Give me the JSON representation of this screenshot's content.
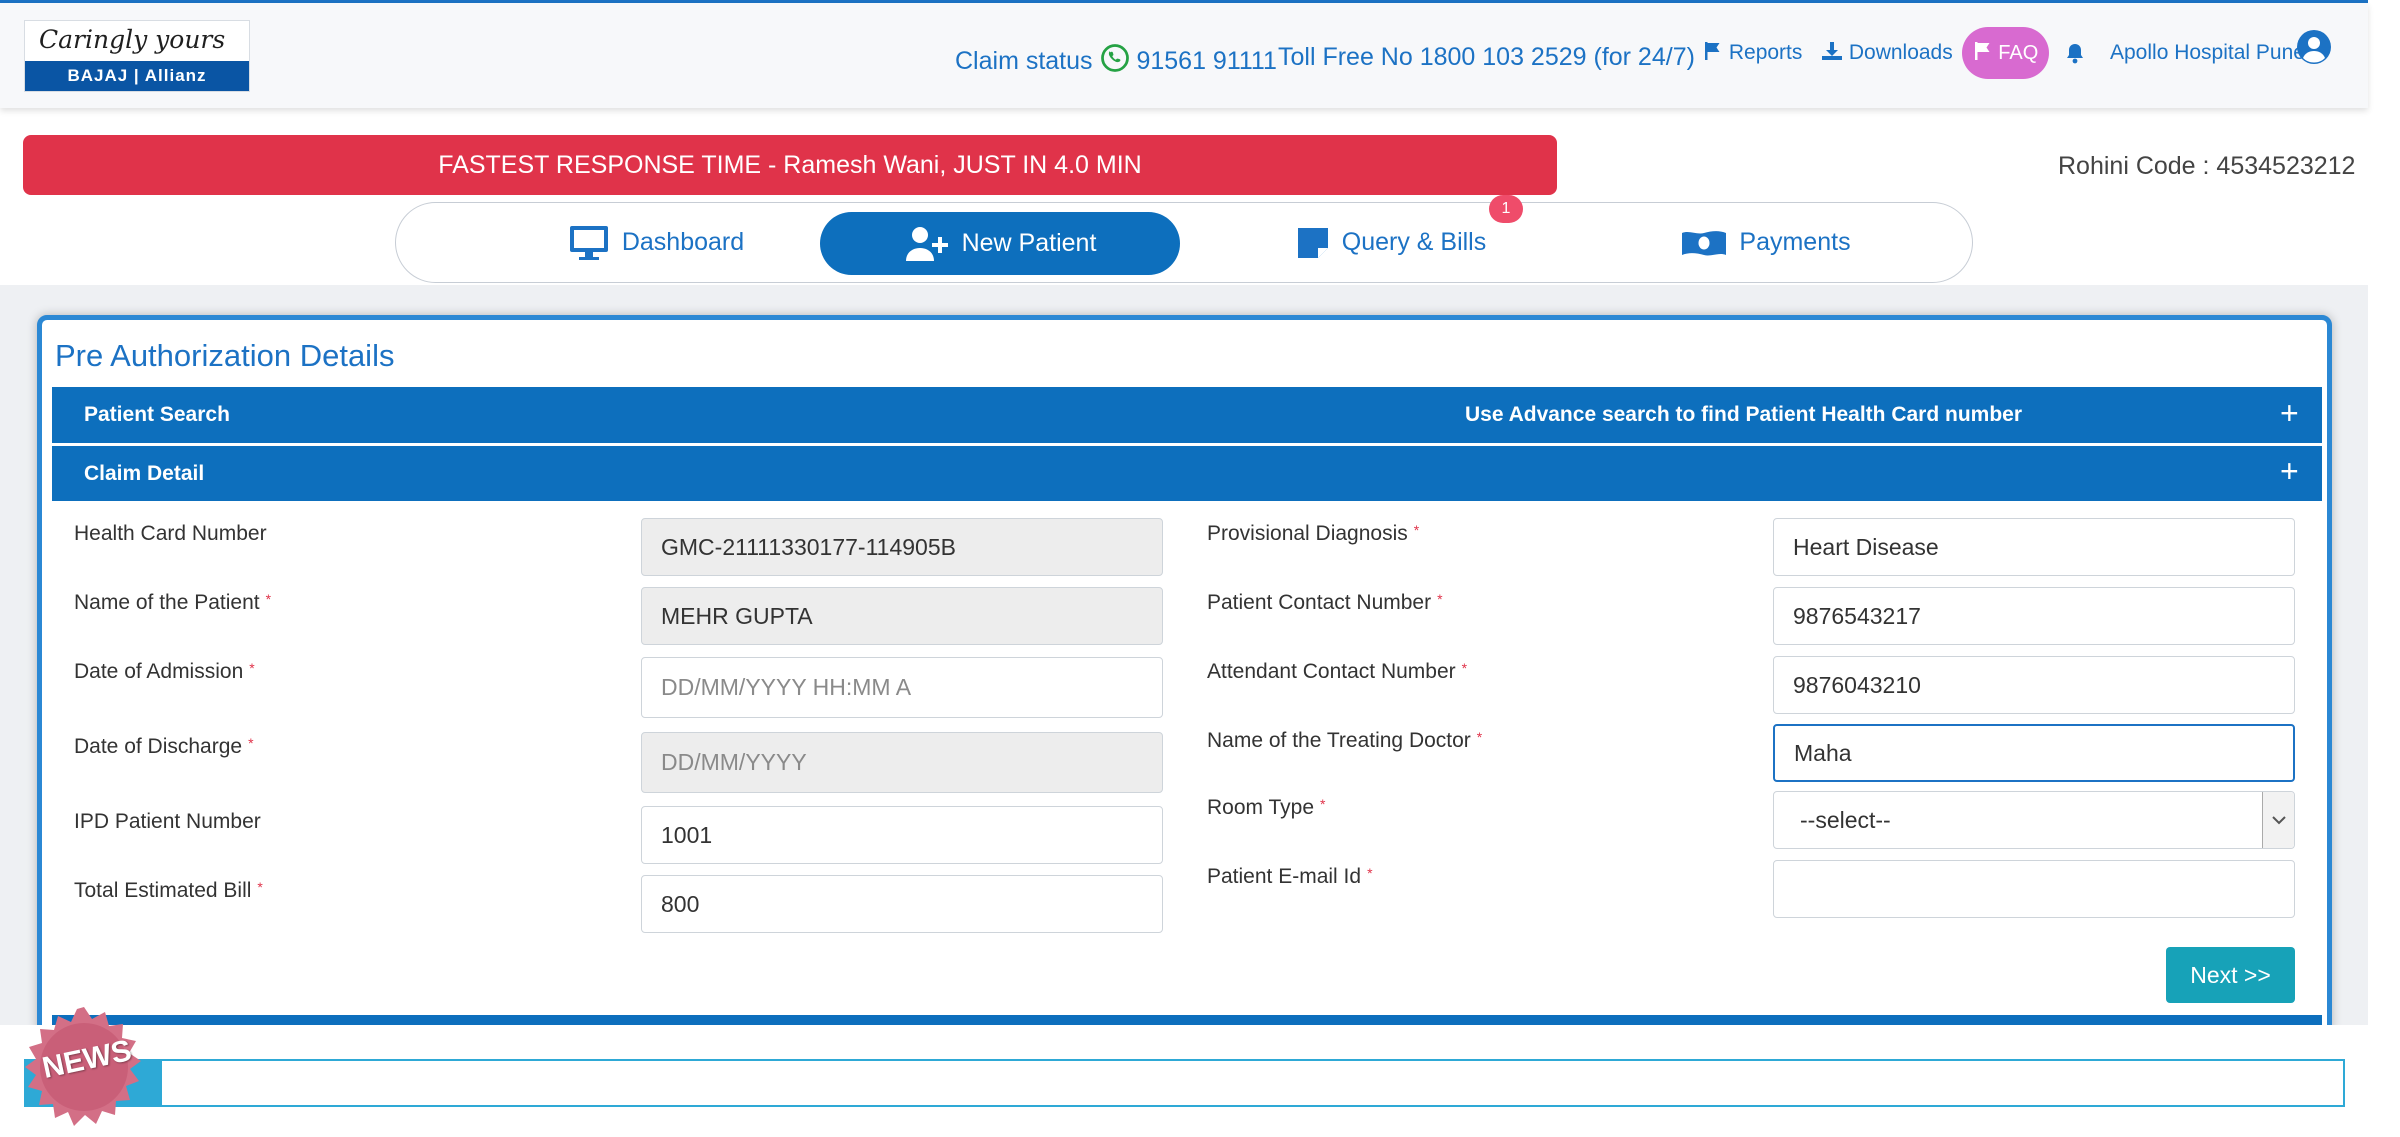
{
  "header": {
    "logo_tagline": "Caringly yours",
    "logo_brand": "BAJAJ | Allianz",
    "claim_status_label": "Claim status",
    "claim_status_number": "91561 91111",
    "toll_free": "Toll Free No 1800 103 2529 (for 24/7)",
    "reports": "Reports",
    "downloads": "Downloads",
    "faq": "FAQ",
    "hospital": "Apollo Hospital Pune"
  },
  "banner": {
    "text": "FASTEST RESPONSE TIME - Ramesh Wani, JUST IN 4.0 MIN"
  },
  "rohini": "Rohini Code : 4534523212",
  "nav": {
    "tabs": [
      {
        "label": "Dashboard",
        "icon": "monitor-icon",
        "active": false
      },
      {
        "label": "New Patient",
        "icon": "user-plus-icon",
        "active": true
      },
      {
        "label": "Query & Bills",
        "icon": "bill-icon",
        "active": false,
        "badge": "1"
      },
      {
        "label": "Payments",
        "icon": "money-icon",
        "active": false
      }
    ]
  },
  "panel": {
    "title": "Pre Authorization Details",
    "patient_search": {
      "label": "Patient Search",
      "hint": "Use Advance search to find Patient Health Card number",
      "toggle": "+"
    },
    "claim_detail": {
      "label": "Claim Detail",
      "toggle": "+"
    }
  },
  "form": {
    "left": [
      {
        "label": "Health Card Number",
        "required": false,
        "value": "GMC-21111330177-114905B",
        "placeholder": "",
        "readonly": true
      },
      {
        "label": "Name of the Patient",
        "required": true,
        "value": "MEHR GUPTA",
        "placeholder": "",
        "readonly": true
      },
      {
        "label": "Date of Admission",
        "required": true,
        "value": "",
        "placeholder": "DD/MM/YYYY HH:MM A",
        "readonly": false
      },
      {
        "label": "Date of Discharge",
        "required": true,
        "value": "",
        "placeholder": "DD/MM/YYYY",
        "readonly": true
      },
      {
        "label": "IPD Patient Number",
        "required": false,
        "value": "1001",
        "placeholder": "",
        "readonly": false
      },
      {
        "label": "Total Estimated Bill",
        "required": true,
        "value": "800",
        "placeholder": "",
        "readonly": false
      }
    ],
    "right": [
      {
        "label": "Provisional Diagnosis",
        "required": true,
        "value": "Heart Disease"
      },
      {
        "label": "Patient Contact Number",
        "required": true,
        "value": "9876543217"
      },
      {
        "label": "Attendant Contact Number",
        "required": true,
        "value": "9876043210"
      },
      {
        "label": "Name of the Treating Doctor",
        "required": true,
        "value": "Maha"
      },
      {
        "label": "Room Type",
        "required": true,
        "value": "--select--"
      },
      {
        "label": "Patient E-mail Id",
        "required": true,
        "value": ""
      }
    ],
    "required_mark": "*",
    "next_button": "Next >>"
  },
  "news": {
    "badge": "NEWS"
  },
  "colors": {
    "primary": "#0d6fbd",
    "link": "#1c72c4",
    "banner": "#e0334a",
    "faq": "#d86ad0",
    "next": "#17a2b8",
    "whatsapp": "#25a244"
  }
}
